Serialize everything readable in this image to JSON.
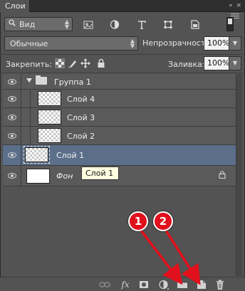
{
  "panel": {
    "title": "Слои",
    "topbar_controls": "«  ×"
  },
  "filter": {
    "kind_label": "Вид"
  },
  "blend": {
    "mode": "Обычные",
    "opacity_label": "Непрозрачность:",
    "opacity_value": "100%"
  },
  "lock": {
    "label": "Закрепить:",
    "fill_label": "Заливка:",
    "fill_value": "100%"
  },
  "layers": [
    {
      "name": "Группа 1",
      "type": "group",
      "visible": true
    },
    {
      "name": "Слой 4",
      "type": "layer",
      "visible": true
    },
    {
      "name": "Слой 3",
      "type": "layer",
      "visible": true
    },
    {
      "name": "Слой 2",
      "type": "layer",
      "visible": true
    },
    {
      "name": "Слой 1",
      "type": "layer",
      "visible": true,
      "selected": true
    },
    {
      "name": "Фон",
      "type": "background",
      "visible": true,
      "locked": true
    }
  ],
  "tooltip": "Слой 1",
  "bottom_toolbar": {
    "fx_label": "fx"
  },
  "annotations": [
    {
      "label": "1"
    },
    {
      "label": "2"
    }
  ],
  "colors": {
    "panel_bg": "#535353",
    "selected_row": "#5b6f8a",
    "annotation_red": "#e0101c"
  }
}
